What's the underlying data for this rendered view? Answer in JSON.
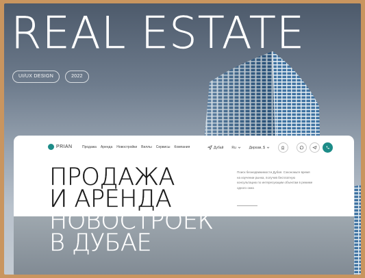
{
  "hero": {
    "title": "REAL ESTATE",
    "chips": [
      "UI/UX DESIGN",
      "2022"
    ]
  },
  "site": {
    "logo": "PRIAN",
    "menu": [
      "Продажа",
      "Аренда",
      "Новостройки",
      "Виллы",
      "Сервисы",
      "Компания"
    ],
    "location": "Дубай",
    "language": "Ru",
    "currency": "Дирхам, $",
    "headline": [
      "ПРОДАЖА",
      "И АРЕНДА",
      "НОВОСТРОЕК",
      "В ДУБАЕ"
    ],
    "description": "Поиск безнедвижимости Дубая. Сэкономьте время на изучении рынка, получив бесплатную консультацию по интересующим объектам в режиме одного окна"
  },
  "colors": {
    "accent": "#1d8c88",
    "frame": "#c9955f"
  },
  "icons": [
    "location-arrow-icon",
    "chevron-down-icon",
    "bookmark-icon",
    "whatsapp-icon",
    "telegram-icon",
    "phone-icon"
  ]
}
